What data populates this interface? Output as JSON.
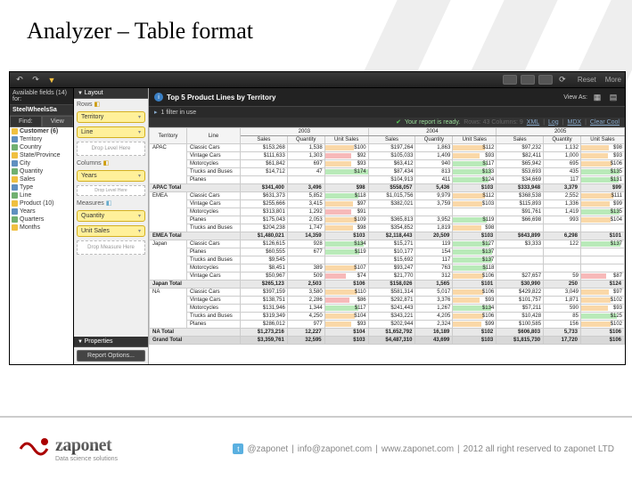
{
  "slide": {
    "title": "Analyzer – Table format"
  },
  "toolbar": {
    "reset": "Reset",
    "more": "More",
    "viewAs": "View As:"
  },
  "leftPane": {
    "available": "Available fields (14) for:",
    "source": "SteelWheelsSa",
    "tabs": {
      "find": "Find:",
      "view": "View"
    },
    "tree": [
      {
        "label": "Customer (6)",
        "parent": true
      },
      {
        "label": "Territory"
      },
      {
        "label": "Country"
      },
      {
        "label": "State/Province"
      },
      {
        "label": "City"
      },
      {
        "label": "Quantity"
      },
      {
        "label": "Sales"
      },
      {
        "label": "Type"
      },
      {
        "label": "Line"
      },
      {
        "label": "Product (10)"
      },
      {
        "label": "Years"
      },
      {
        "label": "Quarters"
      },
      {
        "label": "Months"
      }
    ]
  },
  "layout": {
    "layoutHdr": "Layout",
    "rowsHdr": "Rows",
    "colsHdr": "Columns",
    "measuresHdr": "Measures",
    "propsHdr": "Properties",
    "drop1": "Drop Level Here",
    "drop2": "Drop Measure Here",
    "pills": {
      "territory": "Territory",
      "line": "Line",
      "years": "Years",
      "quantity": "Quantity",
      "unitSales": "Unit Sales"
    },
    "reportOptions": "Report Options..."
  },
  "report": {
    "title": "Top 5 Product Lines by Territory",
    "filter": "1 filter in use",
    "status": "Your report is ready.",
    "rowsCols": "Rows: 43  Columns: 9",
    "exports": {
      "xml": "XML",
      "log": "Log",
      "mdx": "MDX",
      "clear": "Clear Cool"
    }
  },
  "chart_data": {
    "type": "table",
    "row_header": "Territory",
    "sub_header": "Line",
    "years": [
      "2003",
      "2004",
      "2005"
    ],
    "measures": [
      "Sales",
      "Quantity",
      "Unit Sales"
    ],
    "data": [
      {
        "region": "APAC",
        "rows": [
          {
            "line": "Classic Cars",
            "v": [
              "$153,268",
              "1,538",
              "$100",
              "$197,264",
              "1,863",
              "$112",
              "$97,232",
              "1,132",
              "$98"
            ]
          },
          {
            "line": "Vintage Cars",
            "v": [
              "$111,633",
              "1,303",
              "$92",
              "$105,033",
              "1,409",
              "$93",
              "$82,411",
              "1,000",
              "$93"
            ]
          },
          {
            "line": "Motorcycles",
            "v": [
              "$61,842",
              "697",
              "$93",
              "$63,412",
              "940",
              "$117",
              "$65,942",
              "695",
              "$106"
            ]
          },
          {
            "line": "Trucks and Buses",
            "v": [
              "$14,712",
              "47",
              "$174",
              "$87,434",
              "813",
              "$133",
              "$53,693",
              "435",
              "$135"
            ]
          },
          {
            "line": "Planes",
            "v": [
              "",
              "",
              "",
              "$104,913",
              "411",
              "$124",
              "$34,669",
              "117",
              "$131"
            ]
          }
        ],
        "total": {
          "label": "APAC Total",
          "v": [
            "$341,400",
            "3,496",
            "$98",
            "$558,057",
            "5,436",
            "$103",
            "$333,948",
            "3,379",
            "$99"
          ]
        }
      },
      {
        "region": "EMEA",
        "rows": [
          {
            "line": "Classic Cars",
            "v": [
              "$631,373",
              "5,852",
              "$118",
              "$1,015,756",
              "9,979",
              "$112",
              "$368,538",
              "2,552",
              "$111"
            ]
          },
          {
            "line": "Vintage Cars",
            "v": [
              "$255,666",
              "3,415",
              "$97",
              "$382,021",
              "3,759",
              "$103",
              "$115,893",
              "1,336",
              "$99"
            ]
          },
          {
            "line": "Motorcycles",
            "v": [
              "$313,801",
              "1,292",
              "$91",
              "",
              "",
              "",
              "$91,761",
              "1,419",
              "$135"
            ]
          },
          {
            "line": "Planes",
            "v": [
              "$175,043",
              "2,053",
              "$109",
              "$365,813",
              "3,952",
              "$119",
              "$66,698",
              "993",
              "$104"
            ]
          },
          {
            "line": "Trucks and Buses",
            "v": [
              "$204,238",
              "1,747",
              "$98",
              "$354,852",
              "1,819",
              "$98",
              "",
              "",
              ""
            ]
          }
        ],
        "total": {
          "label": "EMEA Total",
          "v": [
            "$1,480,021",
            "14,359",
            "$103",
            "$2,118,443",
            "20,509",
            "$103",
            "$643,899",
            "6,298",
            "$101"
          ]
        }
      },
      {
        "region": "Japan",
        "rows": [
          {
            "line": "Classic Cars",
            "v": [
              "$126,615",
              "928",
              "$134",
              "$15,271",
              "119",
              "$127",
              "$3,333",
              "122",
              "$137"
            ]
          },
          {
            "line": "Planes",
            "v": [
              "$60,555",
              "677",
              "$119",
              "$10,177",
              "154",
              "$137",
              "",
              "",
              ""
            ]
          },
          {
            "line": "Trucks and Buses",
            "v": [
              "$9,545",
              "",
              "",
              "$15,692",
              "117",
              "$137",
              "",
              "",
              ""
            ]
          },
          {
            "line": "Motorcycles",
            "v": [
              "$8,451",
              "389",
              "$107",
              "$93,247",
              "763",
              "$118",
              "",
              "",
              ""
            ]
          },
          {
            "line": "Vintage Cars",
            "v": [
              "$50,967",
              "509",
              "$74",
              "$21,770",
              "312",
              "$106",
              "$27,657",
              "59",
              "$87"
            ]
          }
        ],
        "total": {
          "label": "Japan Total",
          "v": [
            "$265,123",
            "2,503",
            "$106",
            "$158,026",
            "1,565",
            "$101",
            "$30,990",
            "250",
            "$124"
          ]
        }
      },
      {
        "region": "NA",
        "rows": [
          {
            "line": "Classic Cars",
            "v": [
              "$397,159",
              "3,580",
              "$110",
              "$581,314",
              "5,017",
              "$106",
              "$429,822",
              "3,049",
              "$97"
            ]
          },
          {
            "line": "Vintage Cars",
            "v": [
              "$138,751",
              "2,286",
              "$86",
              "$292,871",
              "3,376",
              "$93",
              "$101,757",
              "1,871",
              "$102"
            ]
          },
          {
            "line": "Motorcycles",
            "v": [
              "$131,946",
              "1,344",
              "$117",
              "$241,443",
              "1,267",
              "$134",
              "$57,211",
              "590",
              "$93"
            ]
          },
          {
            "line": "Trucks and Buses",
            "v": [
              "$319,349",
              "4,250",
              "$104",
              "$343,221",
              "4,205",
              "$106",
              "$10,428",
              "85",
              "$125"
            ]
          },
          {
            "line": "Planes",
            "v": [
              "$286,012",
              "977",
              "$93",
              "$202,944",
              "2,324",
              "$99",
              "$100,585",
              "156",
              "$102"
            ]
          }
        ],
        "total": {
          "label": "NA Total",
          "v": [
            "$1,273,216",
            "12,227",
            "$104",
            "$1,652,792",
            "16,189",
            "$102",
            "$606,803",
            "5,733",
            "$106"
          ]
        }
      }
    ],
    "grand": {
      "label": "Grand Total",
      "v": [
        "$3,359,761",
        "32,595",
        "$103",
        "$4,487,310",
        "43,699",
        "$103",
        "$1,815,730",
        "17,720",
        "$106"
      ]
    }
  },
  "footer": {
    "logo": "zaponet",
    "tag": "Data science solutions",
    "twitter": "@zaponet",
    "email": "info@zaponet.com",
    "site": "www.zaponet.com",
    "copy": "2012 all right reserved to zaponet LTD"
  }
}
